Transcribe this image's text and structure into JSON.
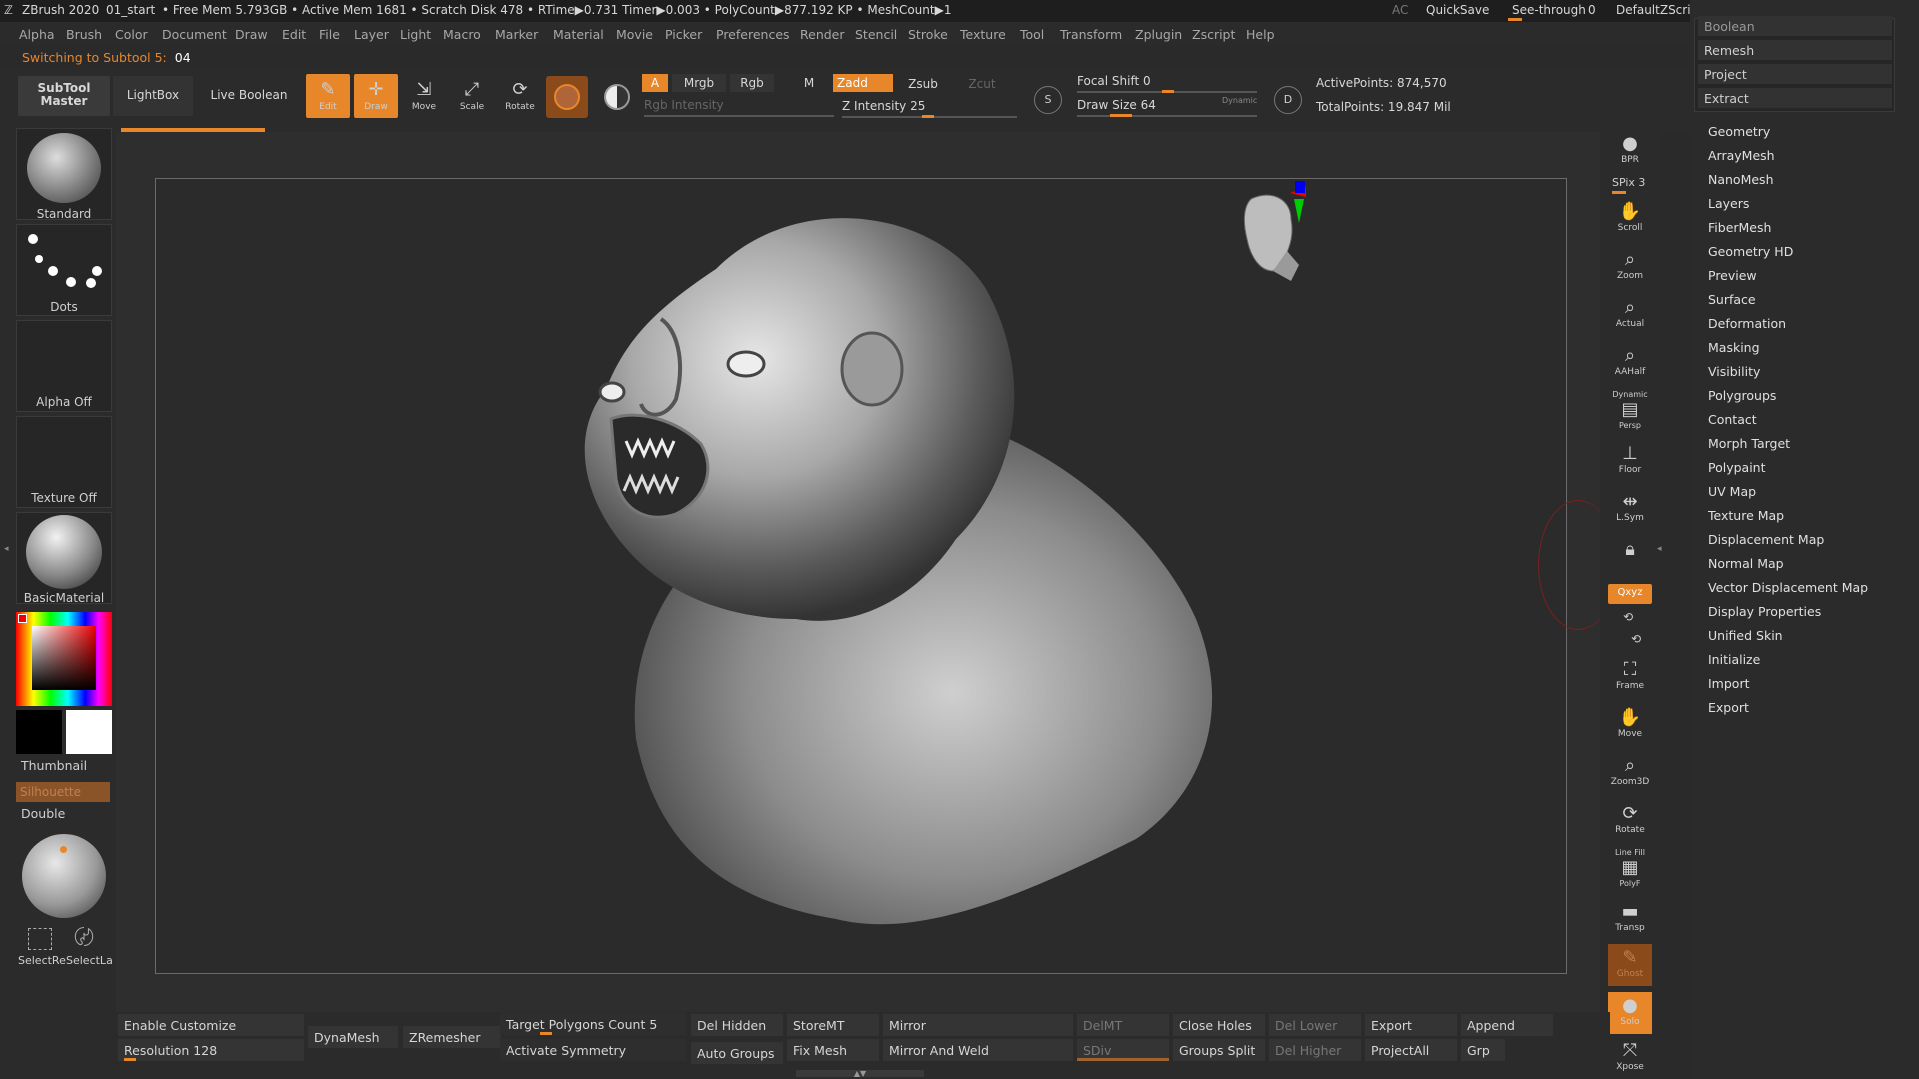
{
  "titlebar": {
    "app": "ZBrush 2020",
    "doc": "01_start",
    "stats": "• Free Mem 5.793GB • Active Mem 1681 • Scratch Disk 478 • RTime▶0.731 Timer▶0.003 • PolyCount▶877.192 KP • MeshCount▶1",
    "ac": "AC",
    "quicksave": "QuickSave",
    "seethrough_label": "See-through",
    "seethrough_value": "0",
    "script": "DefaultZScript"
  },
  "menu": [
    "Alpha",
    "Brush",
    "Color",
    "Document",
    "Draw",
    "Edit",
    "File",
    "Layer",
    "Light",
    "Macro",
    "Marker",
    "Material",
    "Movie",
    "Picker",
    "Preferences",
    "Render",
    "Stencil",
    "Stroke",
    "Texture",
    "Tool",
    "Transform",
    "Zplugin",
    "Zscript",
    "Help"
  ],
  "status": {
    "text": "Switching to Subtool 5:",
    "value": "04"
  },
  "toolbar": {
    "subtool_master": "SubTool Master",
    "lightbox": "LightBox",
    "live_boolean": "Live Boolean",
    "edit": "Edit",
    "draw": "Draw",
    "move": "Move",
    "scale": "Scale",
    "rotate": "Rotate",
    "a": "A",
    "mrgb": "Mrgb",
    "rgb": "Rgb",
    "m": "M",
    "zadd": "Zadd",
    "zsub": "Zsub",
    "zcut": "Zcut",
    "rgb_intensity": "Rgb Intensity",
    "z_intensity_label": "Z Intensity",
    "z_intensity_value": "25",
    "focal_shift_label": "Focal Shift",
    "focal_shift_value": "0",
    "draw_size_label": "Draw Size",
    "draw_size_value": "64",
    "dynamic": "Dynamic",
    "active_points": "ActivePoints: 874,570",
    "total_points": "TotalPoints: 19.847 Mil"
  },
  "left": {
    "brush": "Standard",
    "stroke": "Dots",
    "alpha": "Alpha Off",
    "texture": "Texture Off",
    "material": "BasicMaterial",
    "thumbnail": "Thumbnail",
    "silhouette": "Silhouette",
    "double": "Double",
    "select_rect": "SelectRe",
    "select_lasso": "SelectLa"
  },
  "right": {
    "bpr": "BPR",
    "spix": "SPix 3",
    "scroll": "Scroll",
    "zoom": "Zoom",
    "actual": "Actual",
    "aahalf": "AAHalf",
    "dynamic": "Dynamic",
    "persp": "Persp",
    "floor": "Floor",
    "lsym": "L.Sym",
    "xyz": "Qxyz",
    "frame": "Frame",
    "move": "Move",
    "zoom3d": "Zoom3D",
    "rotate": "Rotate",
    "linefill": "Line Fill",
    "polyf": "PolyF",
    "transp": "Transp",
    "ghost": "Ghost",
    "solo": "Solo",
    "xpose": "Xpose"
  },
  "tool_dropdown": [
    "Boolean",
    "Remesh",
    "Project",
    "Extract"
  ],
  "tool_panel": [
    "Geometry",
    "ArrayMesh",
    "NanoMesh",
    "Layers",
    "FiberMesh",
    "Geometry HD",
    "Preview",
    "Surface",
    "Deformation",
    "Masking",
    "Visibility",
    "Polygroups",
    "Contact",
    "Morph Target",
    "Polypaint",
    "UV Map",
    "Texture Map",
    "Displacement Map",
    "Normal Map",
    "Vector Displacement Map",
    "Display Properties",
    "Unified Skin",
    "Initialize",
    "Import",
    "Export"
  ],
  "bottom": {
    "enable_customize": "Enable Customize",
    "resolution": "Resolution 128",
    "dynamesh": "DynaMesh",
    "zremesher": "ZRemesher",
    "target_polys": "Target Polygons Count 5",
    "activate_symmetry": "Activate Symmetry",
    "del_hidden": "Del Hidden",
    "auto_groups": "Auto Groups",
    "storemt": "StoreMT",
    "fix_mesh": "Fix Mesh",
    "mirror": "Mirror",
    "mirror_weld": "Mirror And Weld",
    "delmt": "DelMT",
    "sdiv": "SDiv",
    "close_holes": "Close Holes",
    "groups_split": "Groups Split",
    "del_lower": "Del Lower",
    "del_higher": "Del Higher",
    "export": "Export",
    "projectall": "ProjectAll",
    "append": "Append",
    "grp": "Grp"
  },
  "colors": {
    "accent": "#e8862a",
    "panel": "#2b2b2b",
    "canvas_border": "#6a6a6a"
  }
}
